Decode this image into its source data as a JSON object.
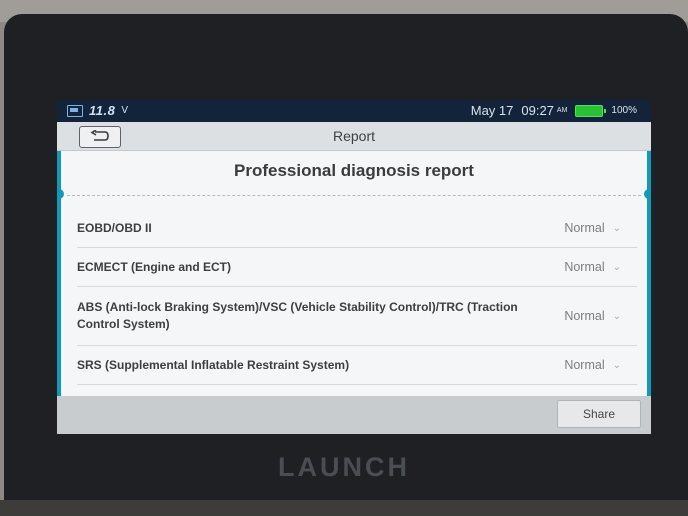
{
  "status_bar": {
    "voltage": "11.8",
    "voltage_unit": "V",
    "date": "May 17",
    "time": "09:27",
    "ampm": "AM",
    "battery_percent": "100%"
  },
  "title_bar": {
    "title": "Report"
  },
  "report": {
    "heading": "Professional diagnosis report",
    "rows": [
      {
        "label": "EOBD/OBD II",
        "status": "Normal"
      },
      {
        "label": "ECMECT (Engine and ECT)",
        "status": "Normal"
      },
      {
        "label": "ABS (Anti-lock Braking System)/VSC (Vehicle Stability Control)/TRC (Traction Control System)",
        "status": "Normal"
      },
      {
        "label": "SRS (Supplemental Inflatable Restraint System)",
        "status": "Normal"
      }
    ]
  },
  "bottom_bar": {
    "share_label": "Share"
  },
  "device": {
    "brand": "LAUNCH"
  },
  "colors": {
    "accent": "#119ab8",
    "battery": "#29c232"
  }
}
